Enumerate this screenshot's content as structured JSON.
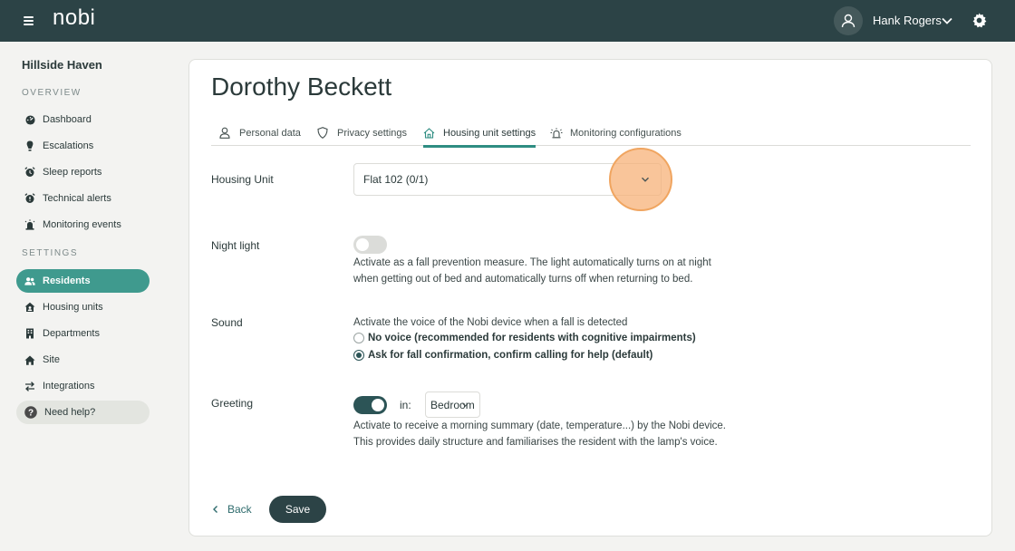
{
  "header": {
    "logo": "nobi",
    "user_name": "Hank Rogers",
    "icons": [
      "menu-icon",
      "user-icon",
      "chevron-down-icon",
      "gear-icon"
    ]
  },
  "sidebar": {
    "site_name": "Hillside Haven",
    "overview_label": "OVERVIEW",
    "settings_label": "SETTINGS",
    "overview_items": [
      {
        "label": "Dashboard",
        "icon": "dashboard-icon"
      },
      {
        "label": "Escalations",
        "icon": "escalation-icon"
      },
      {
        "label": "Sleep reports",
        "icon": "alarm-icon"
      },
      {
        "label": "Technical alerts",
        "icon": "alarm-icon"
      },
      {
        "label": "Monitoring events",
        "icon": "siren-icon"
      }
    ],
    "settings_items": [
      {
        "label": "Residents",
        "icon": "users-icon",
        "active": true
      },
      {
        "label": "Housing units",
        "icon": "house-icon"
      },
      {
        "label": "Departments",
        "icon": "building-icon"
      },
      {
        "label": "Site",
        "icon": "home-icon"
      },
      {
        "label": "Integrations",
        "icon": "arrows-icon"
      }
    ],
    "help_label": "Need help?"
  },
  "main": {
    "resident_name": "Dorothy Beckett",
    "tabs": [
      {
        "label": "Personal data",
        "icon": "person-icon"
      },
      {
        "label": "Privacy settings",
        "icon": "shield-icon"
      },
      {
        "label": "Housing unit settings",
        "icon": "house-icon",
        "active": true
      },
      {
        "label": "Monitoring configurations",
        "icon": "siren-icon"
      }
    ],
    "housing_unit": {
      "label": "Housing Unit",
      "value": "Flat 102 (0/1)"
    },
    "night_light": {
      "label": "Night light",
      "enabled": false,
      "desc_line1": "Activate as a fall prevention measure. The light automatically turns on at night",
      "desc_line2": "when getting out of bed and automatically turns off when returning to bed."
    },
    "sound": {
      "label": "Sound",
      "description": "Activate the voice of the Nobi device when a fall is detected",
      "options": [
        {
          "label": "No voice (recommended for residents with cognitive impairments)",
          "checked": false
        },
        {
          "label": "Ask for fall confirmation, confirm calling for help (default)",
          "checked": true
        }
      ]
    },
    "greeting": {
      "label": "Greeting",
      "enabled": true,
      "in_label": "in:",
      "room": "Bedroom",
      "desc_line1": "Activate to receive a morning summary (date, temperature...) by the Nobi device.",
      "desc_line2": "This provides daily structure and familiarises the resident with the lamp's voice."
    },
    "back_label": "Back",
    "save_label": "Save"
  },
  "colors": {
    "topbar": "#2c4346",
    "accent": "#3f9a8e",
    "highlight": "#f7b278"
  }
}
